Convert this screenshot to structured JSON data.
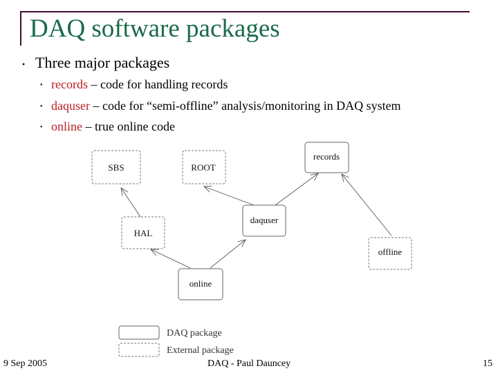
{
  "slide": {
    "title": "DAQ software packages",
    "bullet": "Three major packages",
    "sub_bullets": [
      {
        "keyword": "records",
        "text": " – code for handling records"
      },
      {
        "keyword": "daquser",
        "text": " – code for “semi-offline” analysis/monitoring in DAQ system"
      },
      {
        "keyword": "online",
        "text": " – true online code"
      }
    ]
  },
  "diagram": {
    "nodes": {
      "sbs": {
        "label": "SBS",
        "type": "external"
      },
      "root": {
        "label": "ROOT",
        "type": "external"
      },
      "records": {
        "label": "records",
        "type": "daq"
      },
      "daquser": {
        "label": "daquser",
        "type": "daq"
      },
      "hal": {
        "label": "HAL",
        "type": "external"
      },
      "offline": {
        "label": "offline",
        "type": "external"
      },
      "online": {
        "label": "online",
        "type": "daq"
      }
    },
    "edges": [
      {
        "from": "hal",
        "to": "sbs"
      },
      {
        "from": "daquser",
        "to": "root"
      },
      {
        "from": "daquser",
        "to": "records"
      },
      {
        "from": "offline",
        "to": "records"
      },
      {
        "from": "online",
        "to": "hal"
      },
      {
        "from": "online",
        "to": "daquser"
      }
    ],
    "legend": {
      "daq": "DAQ package",
      "external": "External package"
    }
  },
  "footer": {
    "date": "9 Sep 2005",
    "center": "DAQ - Paul Dauncey",
    "page": "15"
  },
  "colors": {
    "title": "#1a6b4a",
    "keyword": "#b81c22",
    "frame": "#3a0f2e"
  }
}
